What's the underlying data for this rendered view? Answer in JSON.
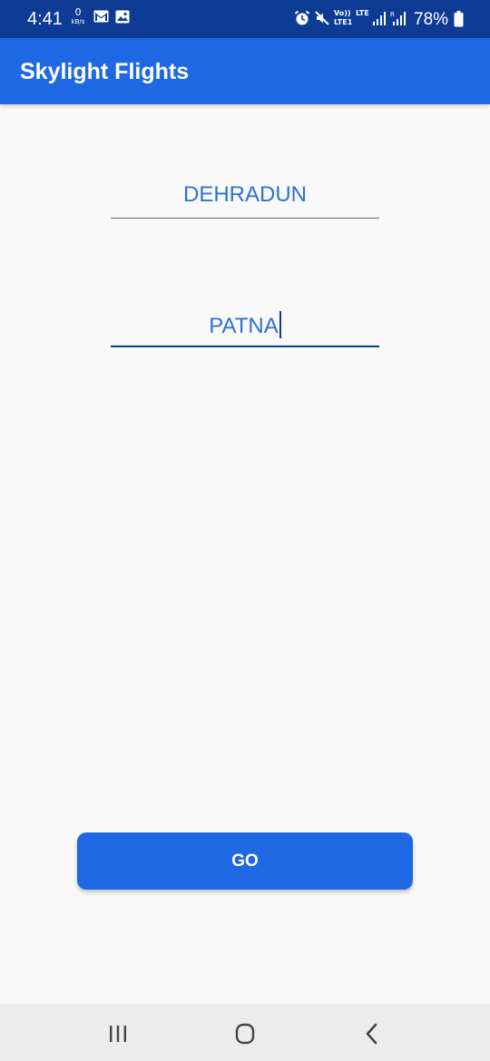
{
  "status_bar": {
    "time": "4:41",
    "kbs_value": "0",
    "kbs_unit": "kB/s",
    "lte_label": "Vo))",
    "lte_sub": "LTE1",
    "lte_label2": "LTE",
    "battery": "78%",
    "icons": [
      "gmail-icon",
      "gallery-icon",
      "alarm-icon",
      "mute-icon",
      "signal-icon",
      "signal-roaming-icon",
      "battery-icon"
    ]
  },
  "app_bar": {
    "title": "Skylight Flights"
  },
  "form": {
    "from_value": "DEHRADUN",
    "to_value": "PATNA"
  },
  "go_button": {
    "label": "GO"
  },
  "nav_bar": {
    "icons": [
      "recent-apps-icon",
      "home-icon",
      "back-icon"
    ]
  },
  "colors": {
    "status_bar": "#0e3c94",
    "primary": "#1e69e3",
    "field_text": "#2f6fd6",
    "background": "#f9f9f9"
  }
}
